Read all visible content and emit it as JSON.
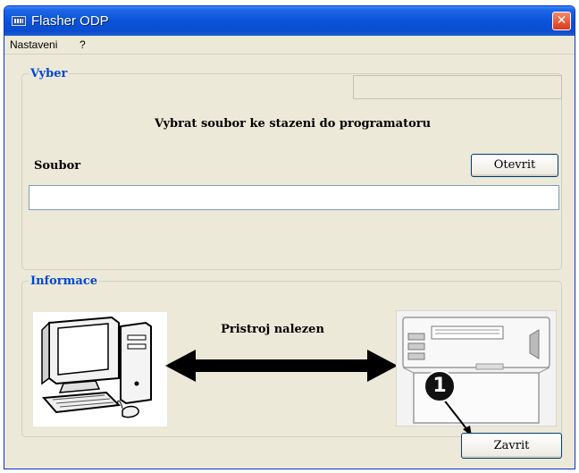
{
  "window": {
    "title": "Flasher ODP",
    "close_glyph": "✕"
  },
  "menu": {
    "items": [
      {
        "label": "Nastaveni"
      },
      {
        "label": "?"
      }
    ]
  },
  "vyber_group": {
    "legend": "Vyber",
    "prompt": "Vybrat soubor ke stazeni do programatoru",
    "file_label": "Soubor",
    "open_button": "Otevrit",
    "file_value": "",
    "status_value": ""
  },
  "info_group": {
    "legend": "Informace",
    "status": "Pristroj nalezen",
    "left_illustration": "computer-icon",
    "right_illustration": "programmer-device-icon",
    "connection_icon": "double-arrow-icon"
  },
  "footer": {
    "close_button": "Zavrit"
  },
  "callout": {
    "number": "1"
  }
}
